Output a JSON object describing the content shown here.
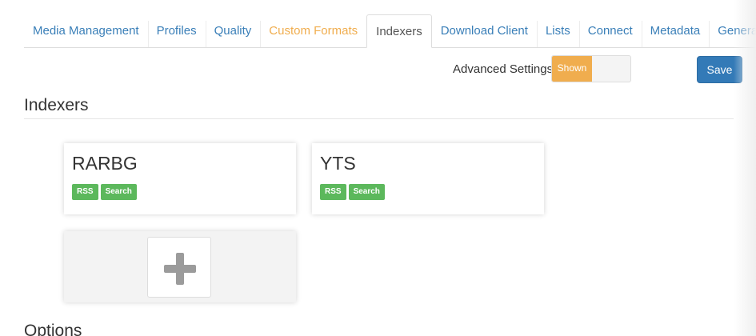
{
  "tabs": [
    {
      "label": "Media Management"
    },
    {
      "label": "Profiles"
    },
    {
      "label": "Quality"
    },
    {
      "label": "Custom Formats"
    },
    {
      "label": "Indexers"
    },
    {
      "label": "Download Client"
    },
    {
      "label": "Lists"
    },
    {
      "label": "Connect"
    },
    {
      "label": "Metadata"
    },
    {
      "label": "General"
    }
  ],
  "active_tab": "Indexers",
  "toolbar": {
    "advanced_settings_label": "Advanced Settings",
    "advanced_toggle_value": "Shown",
    "save_label": "Save"
  },
  "indexers_section": {
    "title": "Indexers",
    "cards": [
      {
        "name": "RARBG",
        "badges": [
          "RSS",
          "Search"
        ]
      },
      {
        "name": "YTS",
        "badges": [
          "RSS",
          "Search"
        ]
      }
    ],
    "add_icon": "plus-icon"
  },
  "options_section": {
    "title": "Options"
  },
  "colors": {
    "link": "#3a7fb8",
    "warning": "#f0ad4e",
    "primary": "#337ab7",
    "success": "#5cb85c"
  }
}
